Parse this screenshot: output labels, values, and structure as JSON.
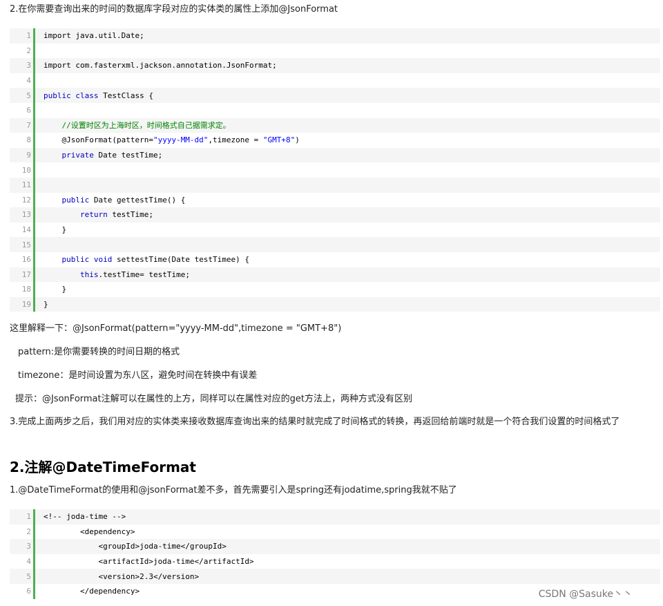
{
  "intro": "2.在你需要查询出来的时间的数据库字段对应的实体类的属性上添加@JsonFormat",
  "code1": [
    {
      "n": "1",
      "parts": [
        {
          "t": "import java.util.Date;",
          "c": ""
        }
      ]
    },
    {
      "n": "2",
      "parts": []
    },
    {
      "n": "3",
      "parts": [
        {
          "t": "import com.fasterxml.jackson.annotation.JsonFormat;",
          "c": ""
        }
      ]
    },
    {
      "n": "4",
      "parts": []
    },
    {
      "n": "5",
      "parts": [
        {
          "t": "public class",
          "c": "kw"
        },
        {
          "t": " TestClass {",
          "c": ""
        }
      ]
    },
    {
      "n": "6",
      "parts": []
    },
    {
      "n": "7",
      "parts": [
        {
          "t": "    ",
          "c": ""
        },
        {
          "t": "//设置时区为上海时区，时间格式自己据需求定。",
          "c": "cmt"
        }
      ]
    },
    {
      "n": "8",
      "parts": [
        {
          "t": "    @JsonFormat(pattern=",
          "c": ""
        },
        {
          "t": "\"yyyy-MM-dd\"",
          "c": "str"
        },
        {
          "t": ",timezone = ",
          "c": ""
        },
        {
          "t": "\"GMT+8\"",
          "c": "str"
        },
        {
          "t": ")",
          "c": ""
        }
      ]
    },
    {
      "n": "9",
      "parts": [
        {
          "t": "    ",
          "c": ""
        },
        {
          "t": "private",
          "c": "kw"
        },
        {
          "t": " Date testTime;",
          "c": ""
        }
      ]
    },
    {
      "n": "10",
      "parts": []
    },
    {
      "n": "11",
      "parts": []
    },
    {
      "n": "12",
      "parts": [
        {
          "t": "    ",
          "c": ""
        },
        {
          "t": "public",
          "c": "kw"
        },
        {
          "t": " Date gettestTime() {",
          "c": ""
        }
      ]
    },
    {
      "n": "13",
      "parts": [
        {
          "t": "        ",
          "c": ""
        },
        {
          "t": "return",
          "c": "kw"
        },
        {
          "t": " testTime;",
          "c": ""
        }
      ]
    },
    {
      "n": "14",
      "parts": [
        {
          "t": "    }",
          "c": ""
        }
      ]
    },
    {
      "n": "15",
      "parts": []
    },
    {
      "n": "16",
      "parts": [
        {
          "t": "    ",
          "c": ""
        },
        {
          "t": "public void",
          "c": "kw"
        },
        {
          "t": " settestTime(Date testTimee) {",
          "c": ""
        }
      ]
    },
    {
      "n": "17",
      "parts": [
        {
          "t": "        ",
          "c": ""
        },
        {
          "t": "this",
          "c": "kw"
        },
        {
          "t": ".testTime= testTime;",
          "c": ""
        }
      ]
    },
    {
      "n": "18",
      "parts": [
        {
          "t": "    }",
          "c": ""
        }
      ]
    },
    {
      "n": "19",
      "parts": [
        {
          "t": "}",
          "c": ""
        }
      ]
    }
  ],
  "explain": "这里解释一下：@JsonFormat(pattern=\"yyyy-MM-dd\",timezone = \"GMT+8\")",
  "pattern_note": "pattern:是你需要转换的时间日期的格式",
  "timezone_note": "timezone：是时间设置为东八区，避免时间在转换中有误差",
  "tip_note": "提示：@JsonFormat注解可以在属性的上方，同样可以在属性对应的get方法上，两种方式没有区别",
  "step3": "3.完成上面两步之后，我们用对应的实体类来接收数据库查询出来的结果时就完成了时间格式的转换，再返回给前端时就是一个符合我们设置的时间格式了",
  "heading": "2.注解@DateTimeFormat",
  "step1b": "1.@DateTimeFormat的使用和@jsonFormat差不多，首先需要引入是spring还有jodatime,spring我就不贴了",
  "code2": [
    {
      "n": "1",
      "parts": [
        {
          "t": "<!-- joda-time -->",
          "c": ""
        }
      ]
    },
    {
      "n": "2",
      "parts": [
        {
          "t": "        <dependency>",
          "c": ""
        }
      ]
    },
    {
      "n": "3",
      "parts": [
        {
          "t": "            <groupId>joda-time</groupId>",
          "c": ""
        }
      ]
    },
    {
      "n": "4",
      "parts": [
        {
          "t": "            <artifactId>joda-time</artifactId>",
          "c": ""
        }
      ]
    },
    {
      "n": "5",
      "parts": [
        {
          "t": "            <version>2.3</version>",
          "c": ""
        }
      ]
    },
    {
      "n": "6",
      "parts": [
        {
          "t": "        </dependency>",
          "c": ""
        }
      ]
    }
  ],
  "watermark": "CSDN @Sasuke丶丶"
}
